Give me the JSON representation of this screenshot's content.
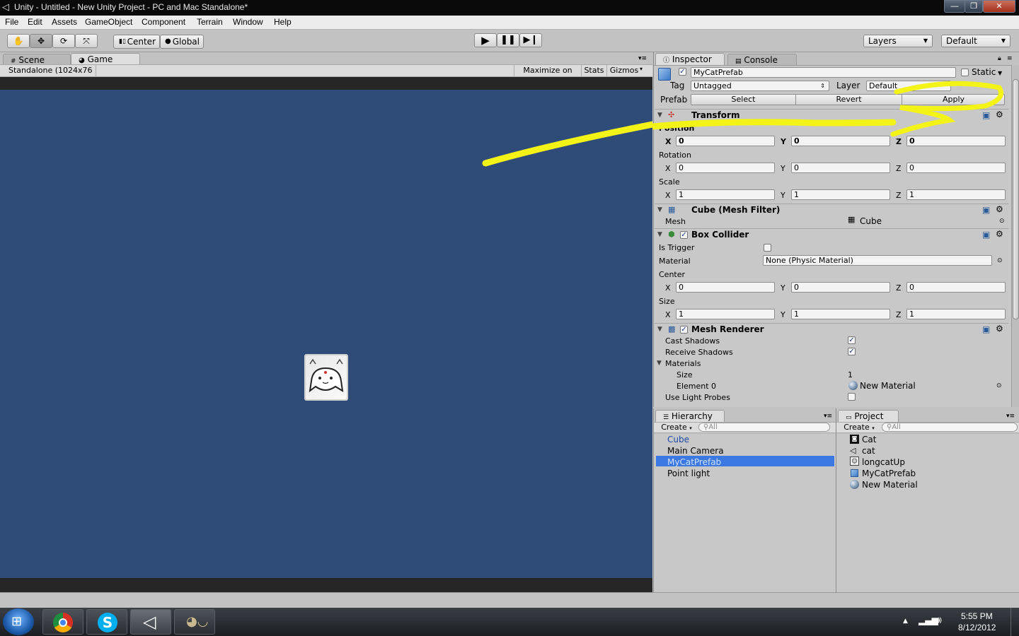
{
  "window": {
    "title": "Unity - Untitled - New Unity Project - PC and Mac Standalone*",
    "controls": [
      "—",
      "❐",
      "✕"
    ]
  },
  "menu": [
    "File",
    "Edit",
    "Assets",
    "GameObject",
    "Component",
    "Terrain",
    "Window",
    "Help"
  ],
  "toolbar": {
    "pivot_mode": "Center",
    "pivot_space": "Global",
    "layers": "Layers",
    "layout": "Default"
  },
  "game_view": {
    "tabs": [
      "Scene",
      "Game"
    ],
    "resolution": "Standalone (1024x76",
    "maximize": "Maximize on Play",
    "stats": "Stats",
    "gizmos": "Gizmos",
    "background": "#2f4c79"
  },
  "inspector": {
    "tabs": [
      "Inspector",
      "Console"
    ],
    "object_name": "MyCatPrefab",
    "static_label": "Static",
    "tag_label": "Tag",
    "tag_value": "Untagged",
    "layer_label": "Layer",
    "layer_value": "Default",
    "prefab_label": "Prefab",
    "prefab_buttons": [
      "Select",
      "Revert",
      "Apply"
    ],
    "transform": {
      "title": "Transform",
      "position_label": "Position",
      "rotation_label": "Rotation",
      "scale_label": "Scale",
      "axis": [
        "X",
        "Y",
        "Z"
      ],
      "position": [
        "0",
        "0",
        "0"
      ],
      "rotation": [
        "0",
        "0",
        "0"
      ],
      "scale": [
        "1",
        "1",
        "1"
      ]
    },
    "mesh_filter": {
      "title": "Cube (Mesh Filter)",
      "mesh_label": "Mesh",
      "mesh_value": "Cube"
    },
    "box_collider": {
      "title": "Box Collider",
      "trigger_label": "Is Trigger",
      "material_label": "Material",
      "material_value": "None (Physic Material)",
      "center_label": "Center",
      "size_label": "Size",
      "center": [
        "0",
        "0",
        "0"
      ],
      "size": [
        "1",
        "1",
        "1"
      ]
    },
    "mesh_renderer": {
      "title": "Mesh Renderer",
      "cast_label": "Cast Shadows",
      "receive_label": "Receive Shadows",
      "materials_label": "Materials",
      "size_label": "Size",
      "size_value": "1",
      "element_label": "Element 0",
      "element_value": "New Material",
      "probes_label": "Use Light Probes"
    }
  },
  "hierarchy": {
    "tab": "Hierarchy",
    "create": "Create",
    "search_placeholder": "All",
    "items": [
      "Cube",
      "Main Camera",
      "MyCatPrefab",
      "Point light"
    ]
  },
  "project": {
    "tab": "Project",
    "create": "Create",
    "search_placeholder": "All",
    "items": [
      "Cat",
      "cat",
      "longcatUp",
      "MyCatPrefab",
      "New Material"
    ]
  },
  "taskbar": {
    "time": "5:55 PM",
    "date": "8/12/2012"
  },
  "colors": {
    "highlight": "#3b78e2",
    "annotation": "#f3f317",
    "scene_bg": "#2f4c79"
  }
}
